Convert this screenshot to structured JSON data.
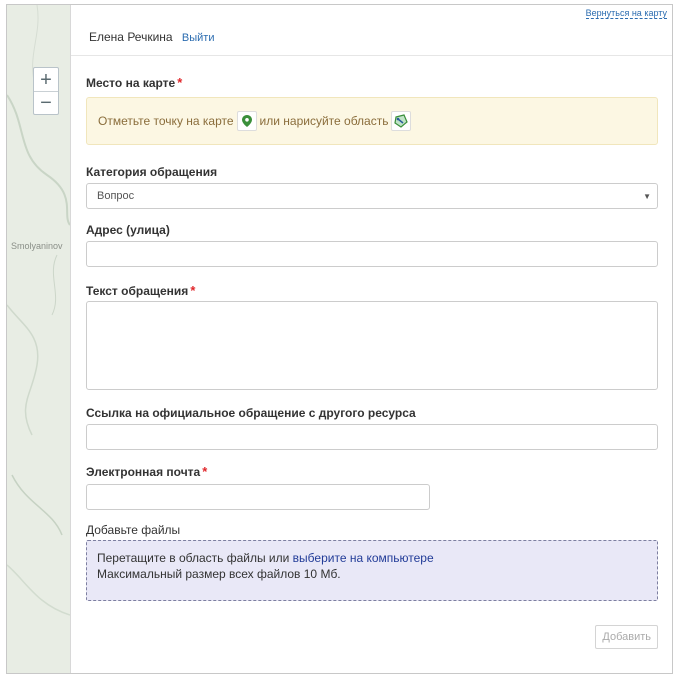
{
  "map": {
    "place_label": "Smolyaninov",
    "zoom_in": "+",
    "zoom_out": "−"
  },
  "header": {
    "back_link": "Вернуться на карту",
    "user_name": "Елена Речкина",
    "logout": "Выйти"
  },
  "location": {
    "label": "Место на карте",
    "required": "*",
    "hint_before": "Отметьте точку на карте",
    "hint_middle": "или нарисуйте область"
  },
  "category": {
    "label": "Категория обращения",
    "selected": "Вопрос",
    "arrow": "▼"
  },
  "address": {
    "label": "Адрес (улица)",
    "value": ""
  },
  "text": {
    "label": "Текст обращения",
    "required": "*",
    "value": ""
  },
  "link": {
    "label": "Ссылка на официальное обращение с другого ресурса",
    "value": ""
  },
  "email": {
    "label": "Электронная почта",
    "required": "*",
    "value": ""
  },
  "files": {
    "label": "Добавьте файлы",
    "drop_text": "Перетащите в область файлы или",
    "pick_link": "выберите на компьютере",
    "limit": "Максимальный размер всех файлов 10 Мб."
  },
  "submit": {
    "label": "Добавить"
  },
  "colors": {
    "link": "#2b6cb0",
    "required": "#e0262a",
    "alert_bg": "#fcf7e3",
    "dropzone_bg": "#e9e8f7",
    "marker": "#3a8f3a"
  }
}
